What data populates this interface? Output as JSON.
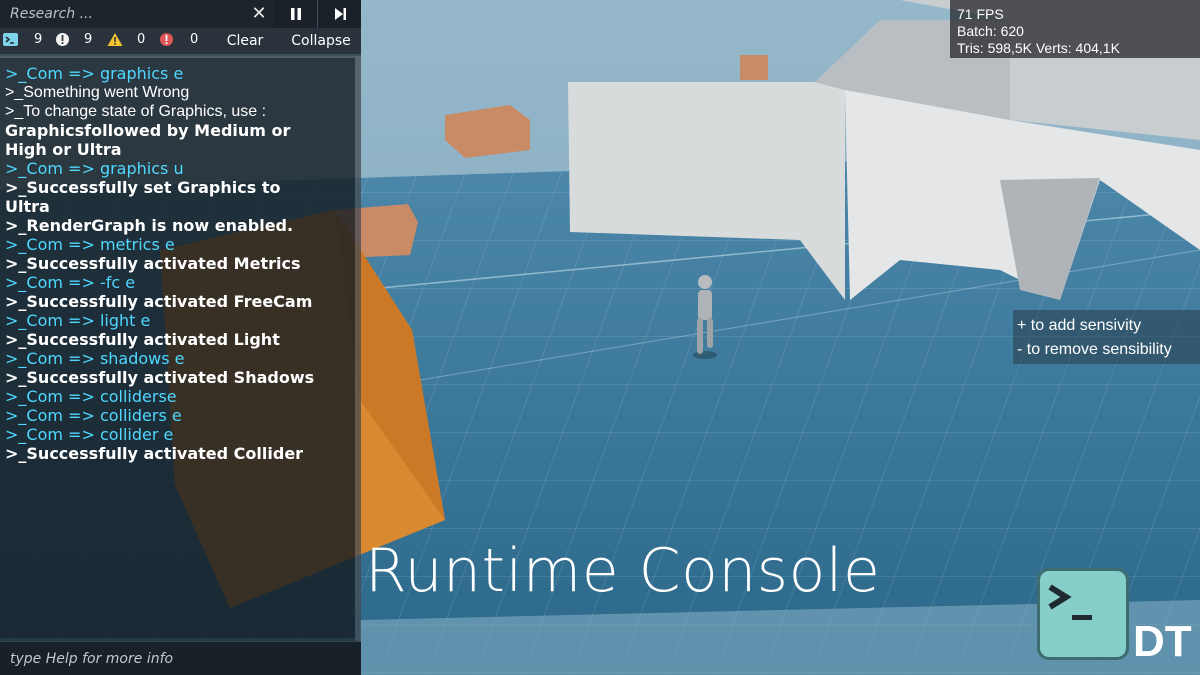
{
  "console": {
    "search_placeholder": "Research ...",
    "clear_icon": "close-icon",
    "pause_icon": "pause-icon",
    "step_icon": "step-forward-icon",
    "filters": [
      {
        "icon": "terminal-icon",
        "count": "9"
      },
      {
        "icon": "info-icon",
        "count": "9"
      },
      {
        "icon": "warning-icon",
        "count": "0"
      },
      {
        "icon": "error-icon",
        "count": "0"
      }
    ],
    "clear_label": "Clear",
    "collapse_label": "Collapse",
    "lines": [
      {
        "text": ">_Com => graphics e",
        "style": "cmd"
      },
      {
        "text": ">_Something went Wrong",
        "style": "reg"
      },
      {
        "text": ">_To change state of Graphics, use :",
        "style": "reg"
      },
      {
        "text": "Graphicsfollowed by Medium or",
        "style": "bold"
      },
      {
        "text": "High or Ultra",
        "style": "bold"
      },
      {
        "text": ">_Com => graphics u",
        "style": "cmd"
      },
      {
        "text": ">_Successfully set Graphics to",
        "style": "bold"
      },
      {
        "text": "Ultra",
        "style": "bold"
      },
      {
        "text": ">_RenderGraph is now enabled.",
        "style": "bold"
      },
      {
        "text": ">_Com => metrics e",
        "style": "cmd"
      },
      {
        "text": ">_Successfully activated Metrics",
        "style": "bold"
      },
      {
        "text": ">_Com => -fc e",
        "style": "cmd"
      },
      {
        "text": ">_Successfully activated FreeCam",
        "style": "bold"
      },
      {
        "text": ">_Com => light e",
        "style": "cmd"
      },
      {
        "text": ">_Successfully activated Light",
        "style": "bold"
      },
      {
        "text": ">_Com => shadows e",
        "style": "cmd"
      },
      {
        "text": ">_Successfully activated Shadows",
        "style": "bold"
      },
      {
        "text": ">_Com => colliderse",
        "style": "cmd"
      },
      {
        "text": ">_Com => colliders e",
        "style": "cmd"
      },
      {
        "text": ">_Com => collider e",
        "style": "cmd"
      },
      {
        "text": ">_Successfully activated Collider",
        "style": "bold"
      }
    ],
    "input_placeholder": "type Help for more info"
  },
  "metrics": {
    "fps": "71 FPS",
    "batch": "Batch: 620",
    "tris_verts": "Tris: 598,5K Verts: 404,1K"
  },
  "sensitivity": {
    "add": "+ to add sensivity",
    "remove": "- to remove sensibility"
  },
  "overlay_title": "Runtime Console",
  "logo": {
    "icon": "terminal-prompt-icon",
    "text": "DT"
  },
  "colors": {
    "command": "#4fd8ff",
    "floor": "#2f6f93",
    "box": "#d9892f",
    "wall": "#d8dbdc",
    "logo": "#86cec9"
  }
}
